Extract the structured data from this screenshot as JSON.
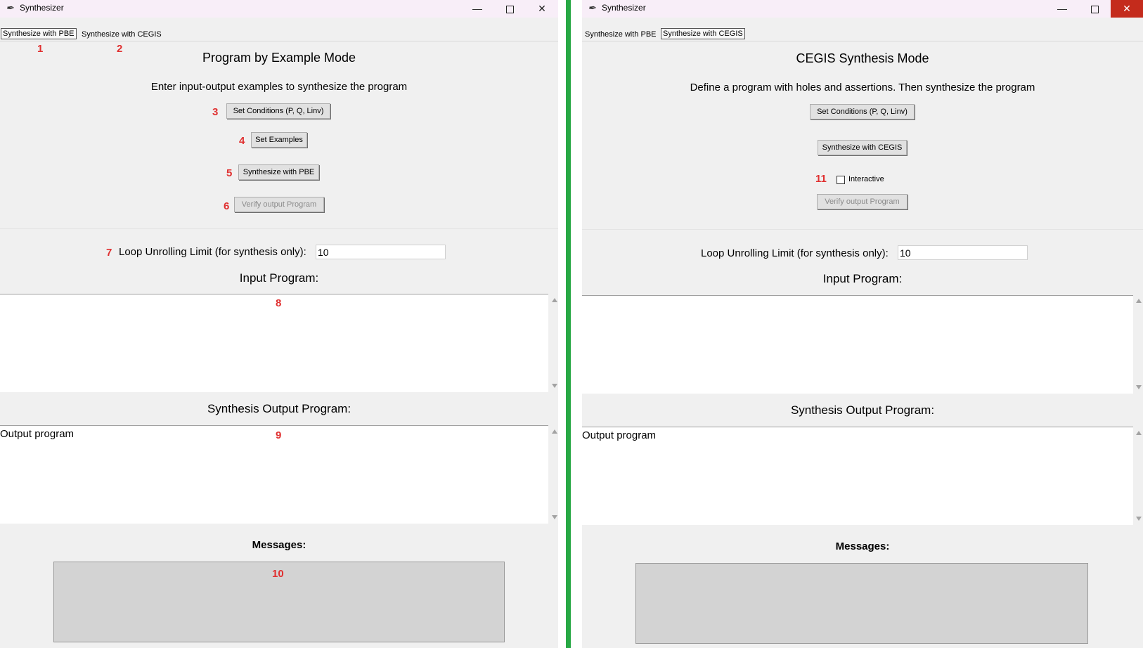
{
  "left": {
    "window_title": "Synthesizer",
    "tabs": [
      "Synthesize with PBE",
      "Synthesize with CEGIS"
    ],
    "mode_title": "Program by Example Mode",
    "description": "Enter input-output examples to synthesize the program",
    "buttons": {
      "set_conditions": "Set Conditions (P, Q, Linv)",
      "set_examples": "Set Examples",
      "synthesize": "Synthesize with PBE",
      "verify": "Verify output Program"
    },
    "loop_label": "Loop Unrolling Limit (for synthesis only):",
    "loop_value": "10",
    "input_program_label": "Input Program:",
    "input_program_text": "",
    "output_program_label": "Synthesis Output Program:",
    "output_program_text": "Output program",
    "messages_label": "Messages:",
    "messages_text": "",
    "annotations": [
      "1",
      "2",
      "3",
      "4",
      "5",
      "6",
      "7",
      "8",
      "9",
      "10"
    ]
  },
  "right": {
    "window_title": "Synthesizer",
    "tabs": [
      "Synthesize with PBE",
      "Synthesize with CEGIS"
    ],
    "mode_title": "CEGIS Synthesis Mode",
    "description": "Define a program with holes and assertions. Then synthesize the program",
    "buttons": {
      "set_conditions": "Set Conditions (P, Q, Linv)",
      "synthesize": "Synthesize with CEGIS",
      "verify": "Verify output Program"
    },
    "interactive_label": "Interactive",
    "interactive_checked": false,
    "loop_label": "Loop Unrolling Limit (for synthesis only):",
    "loop_value": "10",
    "input_program_label": "Input Program:",
    "input_program_text": "",
    "output_program_label": "Synthesis Output Program:",
    "output_program_text": "Output program",
    "messages_label": "Messages:",
    "messages_text": "",
    "annotations": [
      "11"
    ]
  },
  "icons": {
    "app": "feather-icon",
    "minimize": "minimize-icon",
    "maximize": "maximize-icon",
    "close": "close-icon"
  },
  "colors": {
    "divider": "#27a844",
    "annotation": "#e03030",
    "titlebar": "#f8eef8",
    "close_active": "#c42b1c"
  }
}
